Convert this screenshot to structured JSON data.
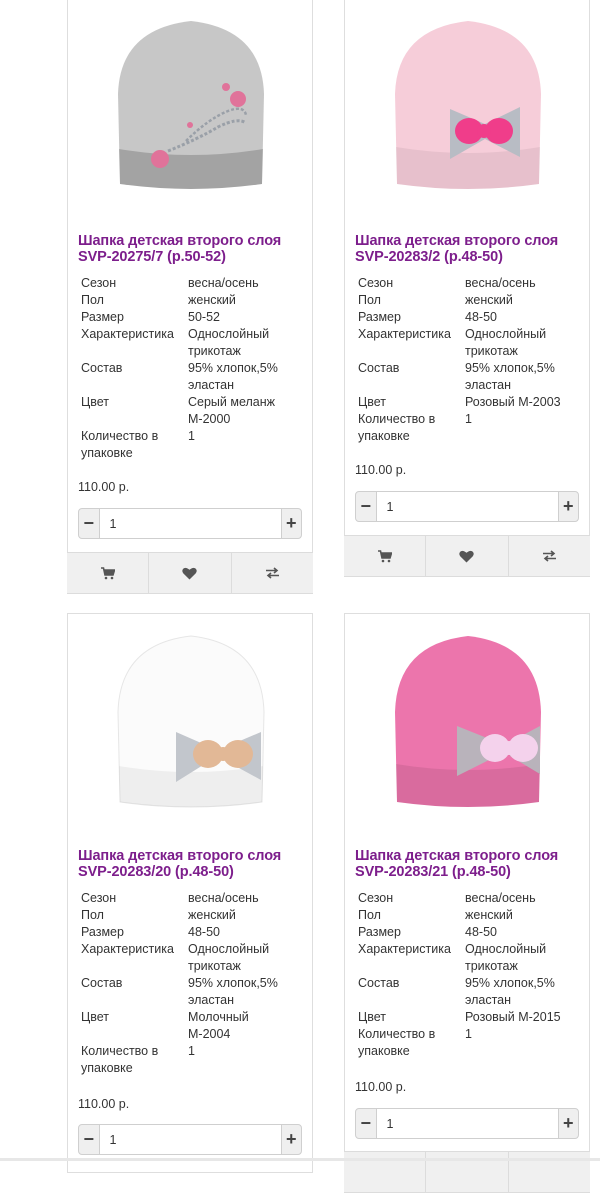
{
  "labels": {
    "season": "Сезон",
    "gender": "Пол",
    "size": "Размер",
    "characteristic": "Характеристика",
    "composition": "Состав",
    "color": "Цвет",
    "pack_qty_1": "Количество в",
    "pack_qty_2": "упаковке"
  },
  "products": [
    {
      "title_line1": "Шапка детская второго слоя",
      "title_line2": "SVP-20275/7 (р.50-52)",
      "season": "весна/осень",
      "gender": "женский",
      "size": "50-52",
      "characteristic_1": "Однослойный",
      "characteristic_2": "трикотаж",
      "composition_1": "95% хлопок,5%",
      "composition_2": "эластан",
      "color_1": "Серый меланж",
      "color_2": "М-2000",
      "pack_qty": "1",
      "price": "110.00 р.",
      "quantity": "1",
      "hat_color": "#c7c7c7",
      "decoration_color": "#e0739a"
    },
    {
      "title_line1": "Шапка детская второго слоя",
      "title_line2": "SVP-20283/2 (р.48-50)",
      "season": "весна/осень",
      "gender": "женский",
      "size": "48-50",
      "characteristic_1": "Однослойный",
      "characteristic_2": "трикотаж",
      "composition_1": "95% хлопок,5%",
      "composition_2": "эластан",
      "color_1": "Розовый М-2003",
      "pack_qty": "1",
      "price": "110.00 р.",
      "quantity": "1",
      "hat_color": "#f6cdd9",
      "decoration_color": "#f03d8a"
    },
    {
      "title_line1": "Шапка детская второго слоя",
      "title_line2": "SVP-20283/20 (р.48-50)",
      "season": "весна/осень",
      "gender": "женский",
      "size": "48-50",
      "characteristic_1": "Однослойный",
      "characteristic_2": "трикотаж",
      "composition_1": "95% хлопок,5%",
      "composition_2": "эластан",
      "color_1": "Молочный",
      "color_2": "М-2004",
      "pack_qty": "1",
      "price": "110.00 р.",
      "quantity": "1",
      "hat_color": "#fbfbfb",
      "decoration_color": "#e2b896"
    },
    {
      "title_line1": "Шапка детская второго слоя",
      "title_line2": "SVP-20283/21 (р.48-50)",
      "season": "весна/осень",
      "gender": "женский",
      "size": "48-50",
      "characteristic_1": "Однослойный",
      "characteristic_2": "трикотаж",
      "composition_1": "95% хлопок,5%",
      "composition_2": "эластан",
      "color_1": "Розовый М-2015",
      "pack_qty": "1",
      "price": "110.00 р.",
      "quantity": "1",
      "hat_color": "#ec75ac",
      "decoration_color": "#f4d2ec"
    }
  ],
  "icons": {
    "cart": "cart-icon",
    "wishlist": "heart-icon",
    "compare": "compare-arrows-icon",
    "minus": "minus-icon",
    "plus": "plus-icon"
  },
  "theme": {
    "title_color": "#7d1e8c",
    "action_bar_bg": "#f0f0f0"
  }
}
